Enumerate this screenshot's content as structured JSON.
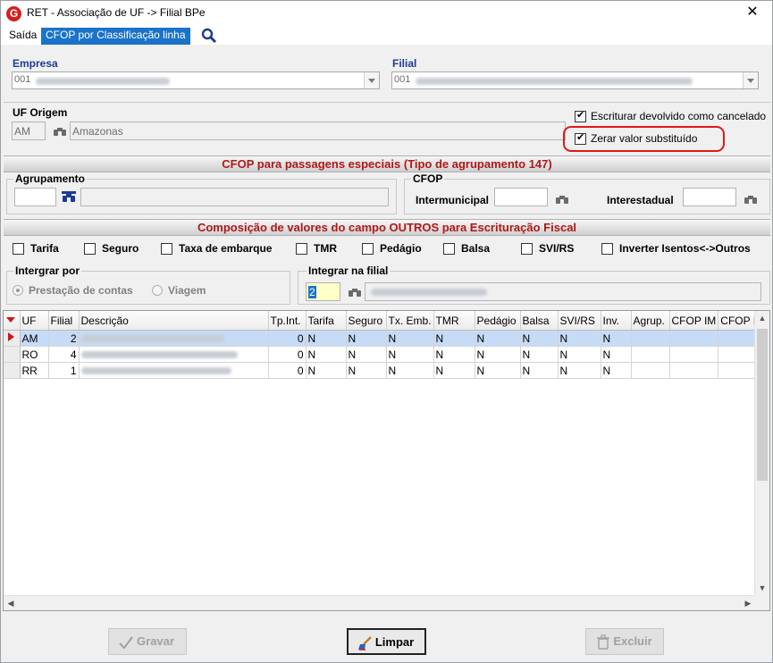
{
  "window": {
    "title": "RET - Associação de UF -> Filial BPe",
    "close_label": "✕",
    "app_icon_letter": "G"
  },
  "menu": {
    "items": [
      "Saída",
      "CFOP por Classificação linha"
    ]
  },
  "empresa": {
    "label": "Empresa",
    "value": "001"
  },
  "filial": {
    "label": "Filial",
    "value": "001"
  },
  "uf_origem": {
    "label": "UF Origem",
    "uf": "AM",
    "name": "Amazonas"
  },
  "options": {
    "escriturar_label": "Escriturar devolvido como cancelado",
    "escriturar_checked": true,
    "zerar_label": "Zerar valor substituído",
    "zerar_checked": true
  },
  "cfop_section": {
    "band_title": "CFOP para passagens especiais (Tipo de agrupamento 147)",
    "agrupamento_label": "Agrupamento",
    "cfop_label": "CFOP",
    "intermunicipal_label": "Intermunicipal",
    "interestadual_label": "Interestadual"
  },
  "composicao": {
    "band_title": "Composição de valores do campo OUTROS para Escrituração Fiscal",
    "checks": [
      "Tarifa",
      "Seguro",
      "Taxa de embarque",
      "TMR",
      "Pedágio",
      "Balsa",
      "SVI/RS",
      "Inverter Isentos<->Outros"
    ]
  },
  "integrar_por": {
    "label": "Intergrar por",
    "options": [
      "Prestação de contas",
      "Viagem"
    ],
    "selected": 0
  },
  "integrar_filial": {
    "label": "Integrar na filial",
    "value": "2"
  },
  "grid": {
    "columns": [
      "UF",
      "Filial",
      "Descrição",
      "Tp.Int.",
      "Tarifa",
      "Seguro",
      "Tx. Emb.",
      "TMR",
      "Pedágio",
      "Balsa",
      "SVI/RS",
      "Inv.",
      "Agrup.",
      "CFOP IM",
      "CFOP IE"
    ],
    "rows": [
      {
        "uf": "AM",
        "filial": "2",
        "tpint": "0",
        "tarifa": "N",
        "seguro": "N",
        "txemb": "N",
        "tmr": "N",
        "pedagio": "N",
        "balsa": "N",
        "svirs": "N",
        "inv": "N",
        "selected": true
      },
      {
        "uf": "RO",
        "filial": "4",
        "tpint": "0",
        "tarifa": "N",
        "seguro": "N",
        "txemb": "N",
        "tmr": "N",
        "pedagio": "N",
        "balsa": "N",
        "svirs": "N",
        "inv": "N",
        "selected": false
      },
      {
        "uf": "RR",
        "filial": "1",
        "tpint": "0",
        "tarifa": "N",
        "seguro": "N",
        "txemb": "N",
        "tmr": "N",
        "pedagio": "N",
        "balsa": "N",
        "svirs": "N",
        "inv": "N",
        "selected": false
      }
    ]
  },
  "buttons": {
    "gravar": "Gravar",
    "limpar": "Limpar",
    "excluir": "Excluir"
  },
  "colors": {
    "accent": "#1a73c8",
    "label_blue": "#1d3b93",
    "band_red": "#b01818",
    "highlight_red": "#e01818"
  }
}
